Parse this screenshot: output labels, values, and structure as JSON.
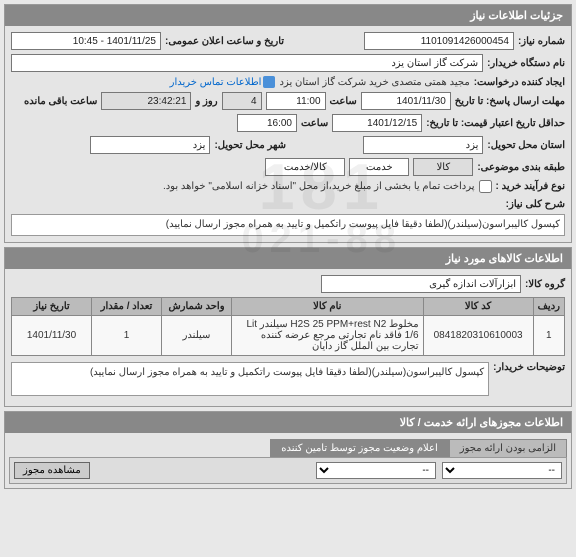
{
  "panel_title": "جزئیات اطلاعات نیاز",
  "req_no_label": "شماره نیاز:",
  "req_no": "1101091426000454",
  "pub_date_label": "تاریخ و ساعت اعلان عمومی:",
  "pub_date": "1401/11/25 - 10:45",
  "buyer_label": "نام دستگاه خریدار:",
  "buyer": "شرکت گاز استان یزد",
  "requester_label": "ایجاد کننده درخواست:",
  "requester": "مجید همتی متصدی خرید شرکت گاز استان یزد",
  "contact_link": "اطلاعات تماس خریدار",
  "deadline_resp_label": "مهلت ارسال پاسخ: تا تاریخ",
  "deadline_resp_date": "1401/11/30",
  "time_label": "ساعت",
  "deadline_resp_time": "11:00",
  "remaining_days_label": "روز و",
  "remaining_days": "4",
  "remaining_time": "23:42:21",
  "remaining_suffix": "ساعت باقی مانده",
  "valid_label": "حداقل تاریخ اعتبار قیمت: تا تاریخ:",
  "valid_date": "1401/12/15",
  "valid_time": "16:00",
  "state_req_label": "استان محل تحویل:",
  "state_req": "یزد",
  "city_req_label": "شهر محل تحویل:",
  "city_req": "یزد",
  "category_label": "طبقه بندی موضوعی:",
  "kala_label": "کالا",
  "khadamat_label": "خدمت",
  "kala_khadamat_label": "کالا/خدمت",
  "purchase_type_label": "نوع فرآیند خرید :",
  "purchase_note": "پرداخت تمام یا بخشی از مبلغ خرید،از محل \"اسناد خزانه اسلامی\" خواهد بود.",
  "desc_title_label": "شرح کلی نیاز:",
  "desc_title": "کپسول کالیبراسون(سیلندر)(لطفا دقیقا  فایل پیوست راتکمیل و تایید به همراه مجوز ارسال نمایید)",
  "goods_panel_title": "اطلاعات کالاهای مورد نیاز",
  "goods_group_label": "گروه کالا:",
  "goods_group": "ابزارآلات اندازه گیری",
  "table": {
    "headers": [
      "ردیف",
      "کد کالا",
      "نام کالا",
      "واحد شمارش",
      "تعداد / مقدار",
      "تاریخ نیاز"
    ],
    "rows": [
      {
        "idx": "1",
        "code": "0841820310610003",
        "name": "مخلوط H2S 25 PPM+rest N2 سیلندر Lit 1/6 فاقد نام تجارتی مرجع عرضه کننده تجارت بین الملل گاز دایان",
        "unit": "سیلندر",
        "qty": "1",
        "date": "1401/11/30"
      }
    ]
  },
  "buyer_notes_label": "توضیحات خریدار:",
  "buyer_notes": "کپسول کالیبراسون(سیلندر)(لطفا دقیقا  فایل پیوست راتکمیل و تایید به همراه مجوز ارسال نمایید)",
  "permits_panel_title": "اطلاعات مجوزهای ارائه خدمت / کالا",
  "tab_mandatory": "الزامی بودن ارائه مجوز",
  "tab_status": "اعلام وضعیت مجوز توسط تامین کننده",
  "status_select_placeholder": "--",
  "view_permit_btn": "مشاهده مجوز",
  "watermark_top": "181",
  "watermark_bottom": "021-88"
}
